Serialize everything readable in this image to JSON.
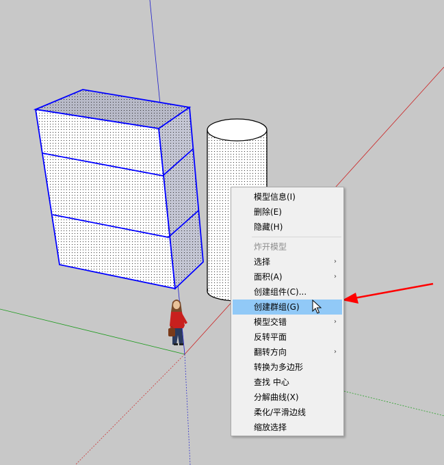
{
  "context_menu": {
    "items": [
      {
        "label": "模型信息(I)",
        "submenu": false,
        "state": "normal"
      },
      {
        "label": "删除(E)",
        "submenu": false,
        "state": "normal"
      },
      {
        "label": "隐藏(H)",
        "submenu": false,
        "state": "normal"
      },
      {
        "separator": true
      },
      {
        "label": "炸开模型",
        "submenu": false,
        "state": "disabled"
      },
      {
        "label": "选择",
        "submenu": true,
        "state": "normal"
      },
      {
        "label": "面积(A)",
        "submenu": true,
        "state": "normal"
      },
      {
        "label": "创建组件(C)...",
        "submenu": false,
        "state": "normal"
      },
      {
        "label": "创建群组(G)",
        "submenu": false,
        "state": "highlighted"
      },
      {
        "label": "模型交错",
        "submenu": true,
        "state": "normal"
      },
      {
        "label": "反转平面",
        "submenu": false,
        "state": "normal"
      },
      {
        "label": "翻转方向",
        "submenu": true,
        "state": "normal"
      },
      {
        "label": "转换为多边形",
        "submenu": false,
        "state": "normal"
      },
      {
        "label": "查找 中心",
        "submenu": false,
        "state": "normal"
      },
      {
        "label": "分解曲线(X)",
        "submenu": false,
        "state": "normal"
      },
      {
        "label": "柔化/平滑边线",
        "submenu": false,
        "state": "normal"
      },
      {
        "label": "缩放选择",
        "submenu": false,
        "state": "normal"
      }
    ],
    "submenu_glyph": "›"
  },
  "viewport": {
    "background": "#c8c8c8",
    "axis_colors": {
      "red": "#cc0000",
      "green": "#00a000",
      "blue": "#0000cc"
    },
    "selection_color": "#0000ff",
    "annotation_arrow_color": "#ff0000"
  }
}
